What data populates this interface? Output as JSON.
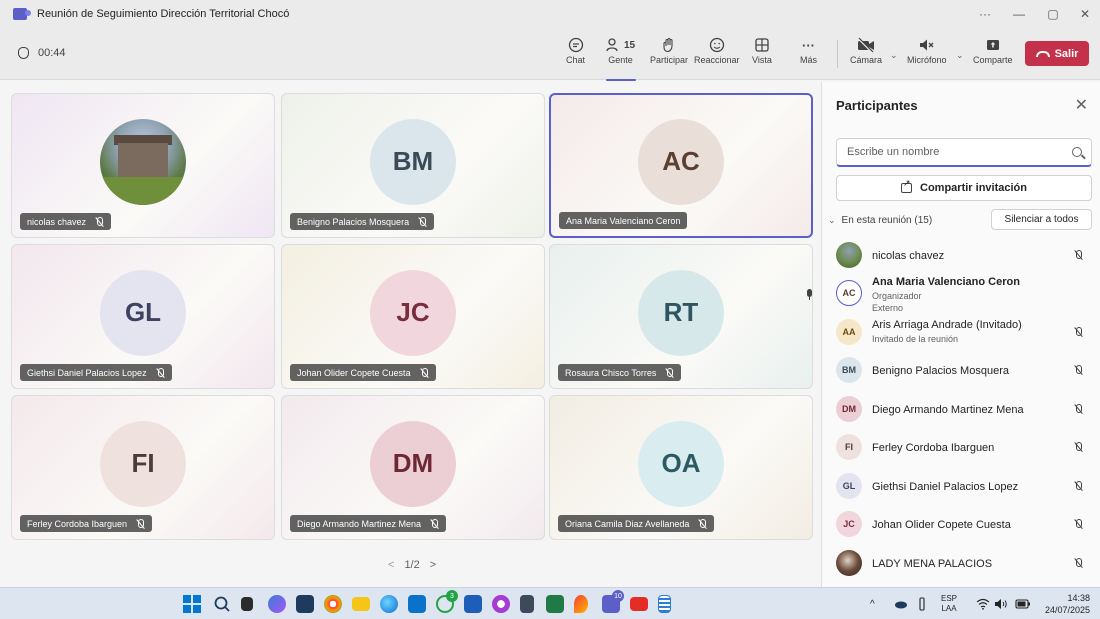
{
  "window": {
    "title": "Reunión de Seguimiento Dirección Territorial Chocó",
    "ctrl_more": "···",
    "ctrl_min": "—",
    "ctrl_restore": "▢",
    "ctrl_close": "✕"
  },
  "toolbar": {
    "timer": "00:44",
    "chat_label": "Chat",
    "people_label": "Gente",
    "people_count": "15",
    "raise_label": "Participar",
    "react_label": "Reaccionar",
    "view_label": "Vista",
    "more_label": "Más",
    "camera_label": "Cámara",
    "mic_label": "Micrófono",
    "share_label": "Comparte",
    "leave_label": "Salir"
  },
  "tiles": [
    {
      "name": "nicolas chavez",
      "initials": "",
      "bg": "#efe6f3",
      "avatar_bg": "photo",
      "muted": true
    },
    {
      "name": "Benigno Palacios Mosquera",
      "initials": "BM",
      "bg": "#eef1ea",
      "avatar_bg": "#dbe6ec",
      "avatar_fg": "#3b4a56",
      "muted": true
    },
    {
      "name": "Ana Maria Valenciano Ceron",
      "initials": "AC",
      "bg": "#f4eaea",
      "avatar_bg": "#eaded9",
      "avatar_fg": "#5a3f33",
      "muted": false,
      "speaking": true
    },
    {
      "name": "Giethsi Daniel Palacios Lopez",
      "initials": "GL",
      "bg": "#f2e7ee",
      "avatar_bg": "#e3e4f0",
      "avatar_fg": "#3e4160",
      "muted": true
    },
    {
      "name": "Johan Olider Copete Cuesta",
      "initials": "JC",
      "bg": "#f3efe1",
      "avatar_bg": "#f2d6dd",
      "avatar_fg": "#7a2d3f",
      "muted": true
    },
    {
      "name": "Rosaura Chisco Torres",
      "initials": "RT",
      "bg": "#e8f0ee",
      "avatar_bg": "#d7e8ea",
      "avatar_fg": "#2f5560",
      "muted": true
    },
    {
      "name": "Ferley Cordoba Ibarguen",
      "initials": "FI",
      "bg": "#f4e9ec",
      "avatar_bg": "#efe2de",
      "avatar_fg": "#4e3b36",
      "muted": true
    },
    {
      "name": "Diego Armando Martinez Mena",
      "initials": "DM",
      "bg": "#f2eaee",
      "avatar_bg": "#eccfd4",
      "avatar_fg": "#6e2834",
      "muted": true
    },
    {
      "name": "Oriana Camila Diaz Avellaneda",
      "initials": "OA",
      "bg": "#f2ede3",
      "avatar_bg": "#d9ecef",
      "avatar_fg": "#2c5a63",
      "muted": true
    }
  ],
  "pager": {
    "prev": "<",
    "label": "1/2",
    "next": ">"
  },
  "panel": {
    "title": "Participantes",
    "close": "✕",
    "search_placeholder": "Escribe un nombre",
    "share_invite": "Compartir invitación",
    "section_label": "En esta reunión (15)",
    "mute_all": "Silenciar a todos",
    "participants": [
      {
        "name": "nicolas chavez",
        "initials": "",
        "avatar": "photo",
        "sub1": "",
        "sub2": "",
        "mic": "off",
        "bold": false
      },
      {
        "name": "Ana Maria Valenciano Ceron",
        "initials": "AC",
        "avatar": "#ffffff",
        "fg": "#5a3f33",
        "sub1": "Organizador",
        "sub2": "Externo",
        "mic": "on",
        "bold": true,
        "ring": true
      },
      {
        "name": "Aris Arriaga Andrade (Invitado)",
        "initials": "AA",
        "avatar": "#f6e7c8",
        "fg": "#6b4d12",
        "sub1": "Invitado de la reunión",
        "sub2": "",
        "mic": "off",
        "bold": false
      },
      {
        "name": "Benigno Palacios Mosquera",
        "initials": "BM",
        "avatar": "#dbe6ec",
        "fg": "#3b4a56",
        "sub1": "",
        "sub2": "",
        "mic": "off",
        "bold": false
      },
      {
        "name": "Diego Armando Martinez Mena",
        "initials": "DM",
        "avatar": "#eccfd4",
        "fg": "#6e2834",
        "sub1": "",
        "sub2": "",
        "mic": "off",
        "bold": false
      },
      {
        "name": "Ferley Cordoba Ibarguen",
        "initials": "FI",
        "avatar": "#efe2de",
        "fg": "#4e3b36",
        "sub1": "",
        "sub2": "",
        "mic": "off",
        "bold": false
      },
      {
        "name": "Giethsi Daniel Palacios Lopez",
        "initials": "GL",
        "avatar": "#e3e4f0",
        "fg": "#3e4160",
        "sub1": "",
        "sub2": "",
        "mic": "off",
        "bold": false
      },
      {
        "name": "Johan Olider Copete Cuesta",
        "initials": "JC",
        "avatar": "#f2d6dd",
        "fg": "#7a2d3f",
        "sub1": "",
        "sub2": "",
        "mic": "off",
        "bold": false
      },
      {
        "name": "LADY MENA PALACIOS",
        "initials": "",
        "avatar": "photo2",
        "sub1": "",
        "sub2": "",
        "mic": "off",
        "bold": false
      }
    ]
  },
  "taskbar": {
    "teams_badge": "10",
    "whatsapp_badge": "3",
    "tray_chevron": "^",
    "lang": "ESP",
    "lang_sub": "LAA",
    "time": "14:38",
    "date": "24/07/2025"
  },
  "colors": {
    "accent": "#5b5fc7",
    "leave": "#c4314b"
  }
}
